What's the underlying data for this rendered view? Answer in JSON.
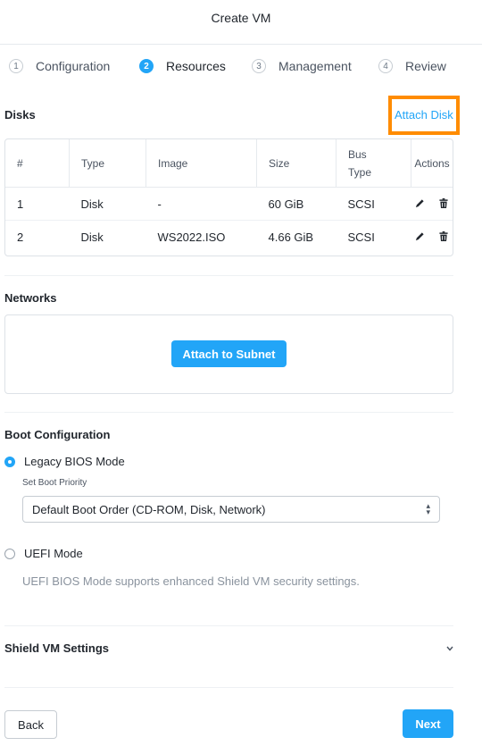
{
  "header": {
    "title": "Create VM"
  },
  "steps": [
    {
      "num": "1",
      "label": "Configuration"
    },
    {
      "num": "2",
      "label": "Resources"
    },
    {
      "num": "3",
      "label": "Management"
    },
    {
      "num": "4",
      "label": "Review"
    }
  ],
  "disks": {
    "title": "Disks",
    "attach_label": "Attach Disk",
    "columns": {
      "num": "#",
      "type": "Type",
      "image": "Image",
      "size": "Size",
      "bus_line1": "Bus",
      "bus_line2": "Type",
      "actions": "Actions"
    },
    "rows": [
      {
        "num": "1",
        "type": "Disk",
        "image": "-",
        "size": "60 GiB",
        "bus": "SCSI"
      },
      {
        "num": "2",
        "type": "Disk",
        "image": "WS2022.ISO",
        "size": "4.66 GiB",
        "bus": "SCSI"
      }
    ]
  },
  "networks": {
    "title": "Networks",
    "attach_label": "Attach to Subnet"
  },
  "boot": {
    "title": "Boot Configuration",
    "legacy_label": "Legacy BIOS Mode",
    "legacy_selected": true,
    "priority_label": "Set Boot Priority",
    "priority_value": "Default Boot Order (CD-ROM, Disk, Network)",
    "uefi_label": "UEFI Mode",
    "uefi_note": "UEFI BIOS Mode supports enhanced Shield VM security settings."
  },
  "shield": {
    "title": "Shield VM Settings"
  },
  "footer": {
    "back_label": "Back",
    "next_label": "Next"
  },
  "colors": {
    "accent": "#22a5f7",
    "highlight": "#ff8c00"
  },
  "icons": {
    "edit": "pencil-icon",
    "delete": "trash-icon",
    "expand": "chevron-down-icon",
    "select": "select-arrows-icon"
  }
}
